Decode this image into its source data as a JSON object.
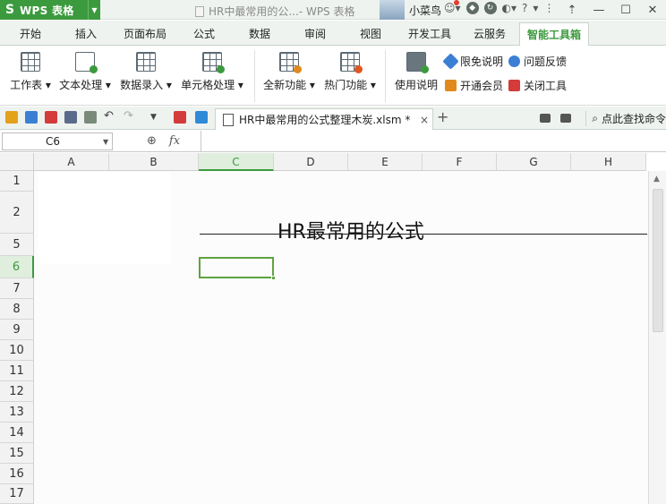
{
  "titlebar": {
    "app_logo": "S",
    "app_name": "WPS 表格",
    "doc_title": "HR中最常用的公...- WPS 表格",
    "username": "小菜鸟",
    "help": "?"
  },
  "menu": {
    "tabs": [
      "开始",
      "插入",
      "页面布局",
      "公式",
      "数据",
      "审阅",
      "视图",
      "开发工具",
      "云服务"
    ],
    "active_tab": "智能工具箱"
  },
  "ribbon": {
    "big_buttons": [
      {
        "label": "工作表",
        "icon": "worksheet-icon"
      },
      {
        "label": "文本处理",
        "icon": "text-process-icon"
      },
      {
        "label": "数据录入",
        "icon": "data-entry-icon"
      },
      {
        "label": "单元格处理",
        "icon": "cell-process-icon"
      },
      {
        "label": "全新功能",
        "icon": "new-feature-icon"
      },
      {
        "label": "热门功能",
        "icon": "hot-feature-icon"
      },
      {
        "label": "使用说明",
        "icon": "usage-guide-icon"
      }
    ],
    "small_buttons": [
      {
        "label": "限免说明",
        "color": "#3b7fd4"
      },
      {
        "label": "问题反馈",
        "color": "#3b7fd4"
      },
      {
        "label": "开通会员",
        "color": "#e08a1e"
      },
      {
        "label": "关闭工具",
        "color": "#d43b3b"
      }
    ]
  },
  "qat": {
    "file_tab": "HR中最常用的公式整理木炭.xlsm *",
    "close": "×",
    "new_tab": "+",
    "find_command": "点此查找命令"
  },
  "formula_bar": {
    "name_box": "C6",
    "fx": "fx"
  },
  "sheet": {
    "columns": [
      "A",
      "B",
      "C",
      "D",
      "E",
      "F",
      "G",
      "H"
    ],
    "selected_column": "C",
    "rows": [
      "1",
      "2",
      "5",
      "6",
      "7",
      "8",
      "9",
      "10",
      "11",
      "12",
      "13",
      "14",
      "15",
      "16",
      "17"
    ],
    "selected_row": "6",
    "title_text": "HR最常用的公式"
  },
  "colors": {
    "accent": "#3c9a3e",
    "selection": "#5fa33f"
  }
}
